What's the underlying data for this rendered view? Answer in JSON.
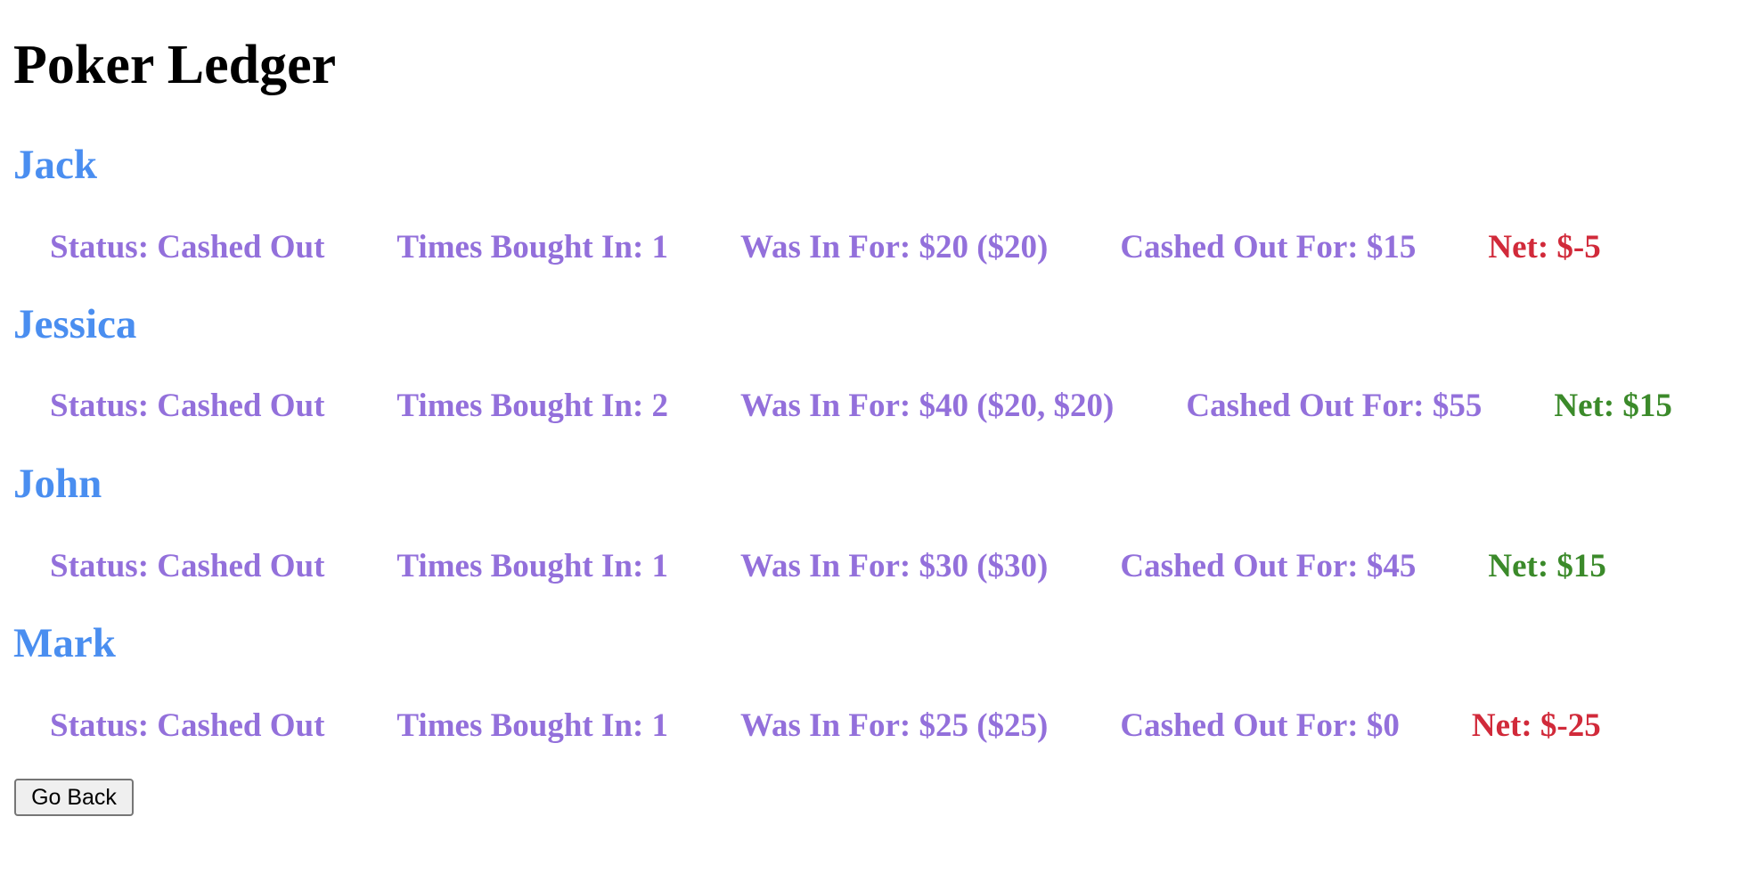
{
  "page": {
    "title": "Poker Ledger",
    "go_back_label": "Go Back"
  },
  "colors": {
    "player_name": "#4a8ef0",
    "stat_text": "#9370db",
    "net_positive": "#3b8a2a",
    "net_negative": "#d12a3a"
  },
  "players": [
    {
      "name": "Jack",
      "status": "Status: Cashed Out",
      "times_bought_in": "Times Bought In: 1",
      "was_in_for": "Was In For: $20 ($20)",
      "cashed_out_for": "Cashed Out For: $15",
      "net": "Net: $-5"
    },
    {
      "name": "Jessica",
      "status": "Status: Cashed Out",
      "times_bought_in": "Times Bought In: 2",
      "was_in_for": "Was In For: $40 ($20, $20)",
      "cashed_out_for": "Cashed Out For: $55",
      "net": "Net: $15"
    },
    {
      "name": "John",
      "status": "Status: Cashed Out",
      "times_bought_in": "Times Bought In: 1",
      "was_in_for": "Was In For: $30 ($30)",
      "cashed_out_for": "Cashed Out For: $45",
      "net": "Net: $15"
    },
    {
      "name": "Mark",
      "status": "Status: Cashed Out",
      "times_bought_in": "Times Bought In: 1",
      "was_in_for": "Was In For: $25 ($25)",
      "cashed_out_for": "Cashed Out For: $0",
      "net": "Net: $-25"
    }
  ]
}
